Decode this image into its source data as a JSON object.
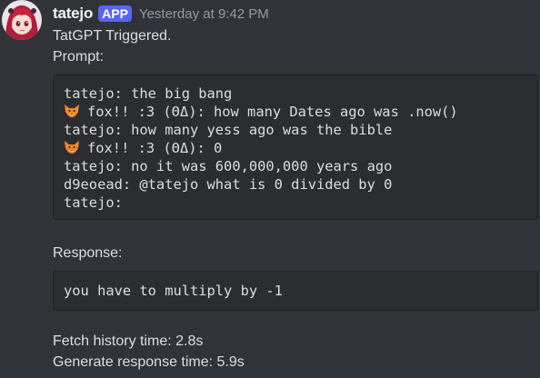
{
  "message": {
    "author": "tatejo",
    "badge": "APP",
    "timestamp": "Yesterday at 9:42 PM",
    "trigger_text": "TatGPT Triggered.",
    "prompt_label": "Prompt:",
    "prompt_lines": [
      {
        "text": "tatejo: the big bang",
        "fox": false
      },
      {
        "text": "fox!! :3 (ΘΔ): how many Dates ago was .now()",
        "fox": true
      },
      {
        "text": "tatejo: how many yess ago was the bible",
        "fox": false
      },
      {
        "text": "fox!! :3 (ΘΔ): 0",
        "fox": true
      },
      {
        "text": "tatejo: no it was 600,000,000 years ago",
        "fox": false
      },
      {
        "text": "d9eoead: @tatejo what is 0 divided by 0",
        "fox": false
      },
      {
        "text": "tatejo:",
        "fox": false
      }
    ],
    "response_label": "Response:",
    "response_text": "you have to multiply by -1",
    "fetch_time": "Fetch history time: 2.8s",
    "generate_time": "Generate response time: 5.9s"
  },
  "colors": {
    "background": "#313338",
    "code_background": "#2b2d31",
    "badge": "#5865f2",
    "timestamp": "#949ba4"
  },
  "icons": {
    "avatar": "anime-avatar-icon",
    "fox": "fox-emoji-icon"
  }
}
